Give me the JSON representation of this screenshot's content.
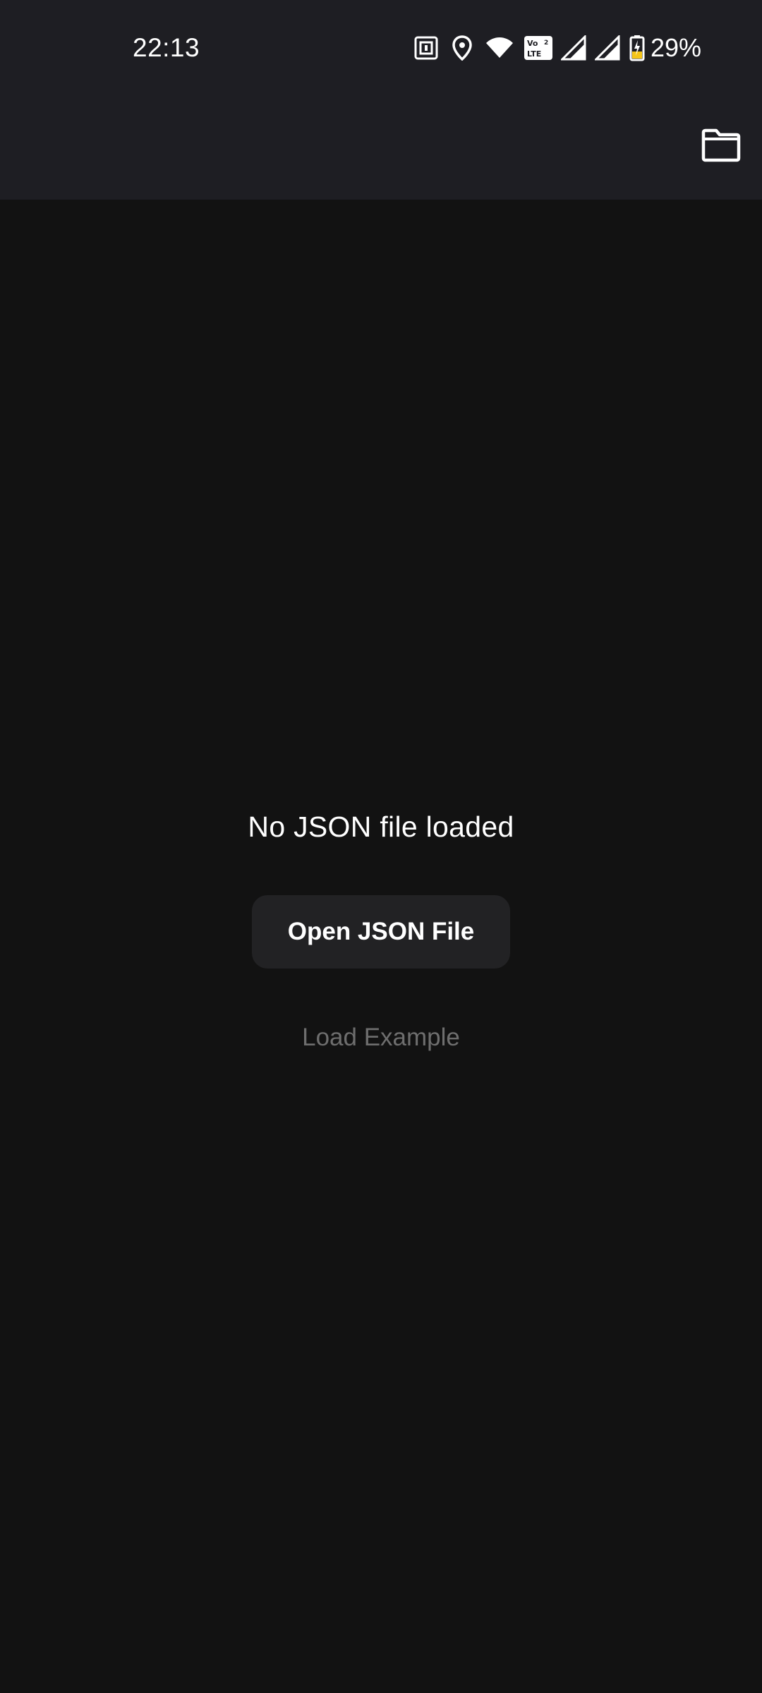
{
  "status_bar": {
    "time": "22:13",
    "battery_percent": "29%",
    "icons": [
      "nfc-icon",
      "location-icon",
      "wifi-icon",
      "volte-icon",
      "signal-icon",
      "signal-icon",
      "battery-charging-icon"
    ],
    "volte_label_top": "Vo",
    "volte_label_bottom": "LTE",
    "volte_sim": "2"
  },
  "app_bar": {
    "action_icon": "folder-icon"
  },
  "main": {
    "empty_message": "No JSON file loaded",
    "open_button_label": "Open JSON File",
    "load_example_label": "Load Example"
  },
  "colors": {
    "top_bar_background": "#1e1e23",
    "page_background": "#121212",
    "button_background": "#222224",
    "secondary_text": "#6e6e6e",
    "battery_charge": "#f5c518"
  }
}
